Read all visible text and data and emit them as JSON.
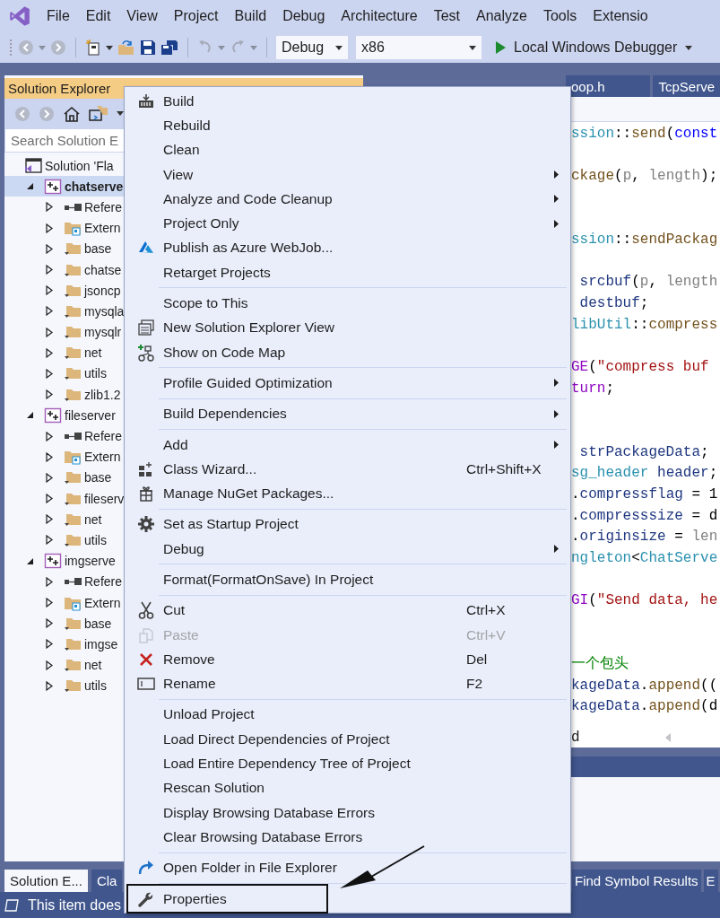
{
  "menu_bar": {
    "items": [
      "File",
      "Edit",
      "View",
      "Project",
      "Build",
      "Debug",
      "Architecture",
      "Test",
      "Analyze",
      "Tools",
      "Extensio"
    ]
  },
  "toolbar": {
    "configuration": "Debug",
    "platform": "x86",
    "run_label": "Local Windows Debugger"
  },
  "solution_explorer": {
    "title": "Solution Explorer",
    "search": {
      "placeholder": "Search Solution E"
    },
    "tree": [
      {
        "label": "Solution 'Fla",
        "kind": "solution",
        "selected": false,
        "children": [
          {
            "label": "chatserve",
            "kind": "project",
            "selected": true,
            "expanded": true,
            "children": [
              {
                "label": "Refere",
                "kind": "references",
                "selected": false,
                "expanded": false
              },
              {
                "label": "Extern",
                "kind": "external",
                "selected": false,
                "expanded": false
              },
              {
                "label": "base",
                "kind": "folder",
                "selected": false,
                "expanded": false
              },
              {
                "label": "chatse",
                "kind": "folder",
                "selected": false,
                "expanded": false
              },
              {
                "label": "jsoncp",
                "kind": "folder",
                "selected": false,
                "expanded": false
              },
              {
                "label": "mysqla",
                "kind": "folder",
                "selected": false,
                "expanded": false
              },
              {
                "label": "mysqlr",
                "kind": "folder",
                "selected": false,
                "expanded": false
              },
              {
                "label": "net",
                "kind": "folder",
                "selected": false,
                "expanded": false
              },
              {
                "label": "utils",
                "kind": "folder",
                "selected": false,
                "expanded": false
              },
              {
                "label": "zlib1.2",
                "kind": "folder",
                "selected": false,
                "expanded": false
              }
            ]
          },
          {
            "label": "fileserver",
            "kind": "project",
            "selected": false,
            "expanded": true,
            "children": [
              {
                "label": "Refere",
                "kind": "references",
                "selected": false,
                "expanded": false
              },
              {
                "label": "Extern",
                "kind": "external",
                "selected": false,
                "expanded": false
              },
              {
                "label": "base",
                "kind": "folder",
                "selected": false,
                "expanded": false
              },
              {
                "label": "fileserv",
                "kind": "folder",
                "selected": false,
                "expanded": false
              },
              {
                "label": "net",
                "kind": "folder",
                "selected": false,
                "expanded": false
              },
              {
                "label": "utils",
                "kind": "folder",
                "selected": false,
                "expanded": false
              }
            ]
          },
          {
            "label": "imgserve",
            "kind": "project",
            "selected": false,
            "expanded": true,
            "children": [
              {
                "label": "Refere",
                "kind": "references",
                "selected": false,
                "expanded": false
              },
              {
                "label": "Extern",
                "kind": "external",
                "selected": false,
                "expanded": false
              },
              {
                "label": "base",
                "kind": "folder",
                "selected": false,
                "expanded": false
              },
              {
                "label": "imgse",
                "kind": "folder",
                "selected": false,
                "expanded": false
              },
              {
                "label": "net",
                "kind": "folder",
                "selected": false,
                "expanded": false
              },
              {
                "label": "utils",
                "kind": "folder",
                "selected": false,
                "expanded": false
              }
            ]
          }
        ]
      }
    ],
    "bottom_tabs": [
      {
        "label": "Solution E...",
        "selected": true
      },
      {
        "label": "Cla",
        "selected": false
      }
    ]
  },
  "editor": {
    "tabs": [
      {
        "label": "oop.h",
        "selected": false
      },
      {
        "label": "TcpServe",
        "selected": false
      }
    ],
    "lines": [
      {
        "kind": "code",
        "segments": [
          {
            "kind": "type",
            "text": "ssion"
          },
          {
            "kind": "plain",
            "text": "::"
          },
          {
            "kind": "func",
            "text": "send"
          },
          {
            "kind": "plain",
            "text": "("
          },
          {
            "kind": "kw",
            "text": "const"
          }
        ]
      },
      {
        "kind": "blank"
      },
      {
        "kind": "code",
        "segments": [
          {
            "kind": "func",
            "text": "ckage"
          },
          {
            "kind": "plain",
            "text": "("
          },
          {
            "kind": "param",
            "text": "p"
          },
          {
            "kind": "plain",
            "text": ", "
          },
          {
            "kind": "param",
            "text": "length"
          },
          {
            "kind": "plain",
            "text": ");"
          }
        ]
      },
      {
        "kind": "blank"
      },
      {
        "kind": "blank"
      },
      {
        "kind": "code",
        "segments": [
          {
            "kind": "type",
            "text": "ssion"
          },
          {
            "kind": "plain",
            "text": "::"
          },
          {
            "kind": "func",
            "text": "sendPackag"
          }
        ]
      },
      {
        "kind": "blank"
      },
      {
        "kind": "code",
        "segments": [
          {
            "kind": "var",
            "text": " srcbuf"
          },
          {
            "kind": "plain",
            "text": "("
          },
          {
            "kind": "param",
            "text": "p"
          },
          {
            "kind": "plain",
            "text": ", "
          },
          {
            "kind": "param",
            "text": "length"
          }
        ]
      },
      {
        "kind": "code",
        "segments": [
          {
            "kind": "var",
            "text": " destbuf"
          },
          {
            "kind": "plain",
            "text": ";"
          }
        ]
      },
      {
        "kind": "code",
        "segments": [
          {
            "kind": "type",
            "text": "libUtil"
          },
          {
            "kind": "plain",
            "text": "::"
          },
          {
            "kind": "func",
            "text": "compress"
          }
        ]
      },
      {
        "kind": "blank"
      },
      {
        "kind": "code",
        "segments": [
          {
            "kind": "macro",
            "text": "GE"
          },
          {
            "kind": "plain",
            "text": "("
          },
          {
            "kind": "str",
            "text": "\"compress buf "
          }
        ]
      },
      {
        "kind": "code",
        "segments": [
          {
            "kind": "macro",
            "text": "turn"
          },
          {
            "kind": "plain",
            "text": ";"
          }
        ]
      },
      {
        "kind": "blank"
      },
      {
        "kind": "blank"
      },
      {
        "kind": "code",
        "segments": [
          {
            "kind": "var",
            "text": " strPackageData"
          },
          {
            "kind": "plain",
            "text": ";"
          }
        ]
      },
      {
        "kind": "code",
        "segments": [
          {
            "kind": "type",
            "text": "sg_header"
          },
          {
            "kind": "var",
            "text": " header"
          },
          {
            "kind": "plain",
            "text": ";"
          }
        ]
      },
      {
        "kind": "code",
        "segments": [
          {
            "kind": "plain",
            "text": "."
          },
          {
            "kind": "var",
            "text": "compressflag"
          },
          {
            "kind": "plain",
            "text": " = 1"
          }
        ]
      },
      {
        "kind": "code",
        "segments": [
          {
            "kind": "plain",
            "text": "."
          },
          {
            "kind": "var",
            "text": "compresssize"
          },
          {
            "kind": "plain",
            "text": " = d"
          }
        ]
      },
      {
        "kind": "code",
        "segments": [
          {
            "kind": "plain",
            "text": "."
          },
          {
            "kind": "var",
            "text": "originsize"
          },
          {
            "kind": "plain",
            "text": " = "
          },
          {
            "kind": "param",
            "text": "len"
          }
        ]
      },
      {
        "kind": "code",
        "segments": [
          {
            "kind": "type",
            "text": "ngleton"
          },
          {
            "kind": "plain",
            "text": "<"
          },
          {
            "kind": "type",
            "text": "ChatServe"
          }
        ]
      },
      {
        "kind": "blank"
      },
      {
        "kind": "code",
        "segments": [
          {
            "kind": "macro",
            "text": "GI"
          },
          {
            "kind": "plain",
            "text": "("
          },
          {
            "kind": "str",
            "text": "\"Send data, he"
          }
        ]
      },
      {
        "kind": "blank"
      },
      {
        "kind": "blank"
      },
      {
        "kind": "code",
        "segments": [
          {
            "kind": "comment",
            "text": "一个包头"
          }
        ]
      },
      {
        "kind": "code",
        "segments": [
          {
            "kind": "var",
            "text": "kageData"
          },
          {
            "kind": "plain",
            "text": "."
          },
          {
            "kind": "func",
            "text": "append"
          },
          {
            "kind": "plain",
            "text": "(("
          }
        ]
      },
      {
        "kind": "code",
        "segments": [
          {
            "kind": "var",
            "text": "kageData"
          },
          {
            "kind": "plain",
            "text": "."
          },
          {
            "kind": "func",
            "text": "append"
          },
          {
            "kind": "plain",
            "text": "(d"
          }
        ]
      }
    ],
    "scroll_row_text": "d",
    "bottom_tabs": [
      {
        "label": "Find Symbol Results",
        "selected": false
      },
      {
        "label": "E",
        "selected": false
      }
    ]
  },
  "context_menu": {
    "groups": [
      [
        {
          "label": "Build",
          "submenu": false,
          "disabled": false,
          "annotated": false
        },
        {
          "label": "Rebuild",
          "submenu": false,
          "disabled": false,
          "annotated": false
        },
        {
          "label": "Clean",
          "submenu": false,
          "disabled": false,
          "annotated": false
        },
        {
          "label": "View",
          "submenu": true,
          "disabled": false,
          "annotated": false
        },
        {
          "label": "Analyze and Code Cleanup",
          "submenu": true,
          "disabled": false,
          "annotated": false
        },
        {
          "label": "Project Only",
          "submenu": true,
          "disabled": false,
          "annotated": false
        },
        {
          "label": "Publish as Azure WebJob...",
          "submenu": false,
          "disabled": false,
          "annotated": false
        },
        {
          "label": "Retarget Projects",
          "submenu": false,
          "disabled": false,
          "annotated": false
        }
      ],
      [
        {
          "label": "Scope to This",
          "submenu": false,
          "disabled": false,
          "annotated": false
        },
        {
          "label": "New Solution Explorer View",
          "submenu": false,
          "disabled": false,
          "annotated": false
        },
        {
          "label": "Show on Code Map",
          "submenu": false,
          "disabled": false,
          "annotated": false
        }
      ],
      [
        {
          "label": "Profile Guided Optimization",
          "submenu": true,
          "disabled": false,
          "annotated": false
        }
      ],
      [
        {
          "label": "Build Dependencies",
          "submenu": true,
          "disabled": false,
          "annotated": false
        }
      ],
      [
        {
          "label": "Add",
          "submenu": true,
          "disabled": false,
          "annotated": false
        },
        {
          "label": "Class Wizard...",
          "shortcut": "Ctrl+Shift+X",
          "submenu": false,
          "disabled": false,
          "annotated": false
        },
        {
          "label": "Manage NuGet Packages...",
          "submenu": false,
          "disabled": false,
          "annotated": false
        }
      ],
      [
        {
          "label": "Set as Startup Project",
          "submenu": false,
          "disabled": false,
          "annotated": false
        },
        {
          "label": "Debug",
          "submenu": true,
          "disabled": false,
          "annotated": false
        }
      ],
      [
        {
          "label": "Format(FormatOnSave) In Project",
          "submenu": false,
          "disabled": false,
          "annotated": false
        }
      ],
      [
        {
          "label": "Cut",
          "shortcut": "Ctrl+X",
          "submenu": false,
          "disabled": false,
          "annotated": false
        },
        {
          "label": "Paste",
          "shortcut": "Ctrl+V",
          "submenu": false,
          "disabled": true,
          "annotated": false
        },
        {
          "label": "Remove",
          "shortcut": "Del",
          "submenu": false,
          "disabled": false,
          "annotated": false
        },
        {
          "label": "Rename",
          "shortcut": "F2",
          "submenu": false,
          "disabled": false,
          "annotated": false
        }
      ],
      [
        {
          "label": "Unload Project",
          "submenu": false,
          "disabled": false,
          "annotated": false
        },
        {
          "label": "Load Direct Dependencies of Project",
          "submenu": false,
          "disabled": false,
          "annotated": false
        },
        {
          "label": "Load Entire Dependency Tree of Project",
          "submenu": false,
          "disabled": false,
          "annotated": false
        },
        {
          "label": "Rescan Solution",
          "submenu": false,
          "disabled": false,
          "annotated": false
        },
        {
          "label": "Display Browsing Database Errors",
          "submenu": false,
          "disabled": false,
          "annotated": false
        },
        {
          "label": "Clear Browsing Database Errors",
          "submenu": false,
          "disabled": false,
          "annotated": false
        }
      ],
      [
        {
          "label": "Open Folder in File Explorer",
          "submenu": false,
          "disabled": false,
          "annotated": false
        }
      ],
      [
        {
          "label": "Properties",
          "submenu": false,
          "disabled": false,
          "annotated": true
        }
      ]
    ]
  },
  "status_bar": {
    "message": "This item does"
  }
}
